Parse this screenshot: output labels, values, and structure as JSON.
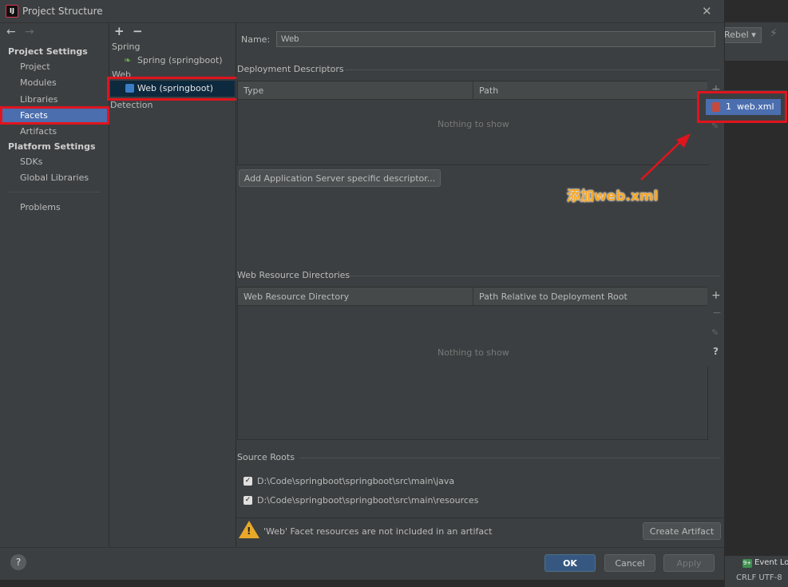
{
  "window": {
    "title": "Project Structure",
    "app_icon_label": "IJ"
  },
  "nav": {
    "back": "←",
    "forward": "→",
    "project_settings": "Project Settings",
    "project_items": [
      "Project",
      "Modules",
      "Libraries",
      "Facets",
      "Artifacts"
    ],
    "platform_settings": "Platform Settings",
    "platform_items": [
      "SDKs",
      "Global Libraries"
    ],
    "problems": "Problems",
    "selected": "Facets"
  },
  "facet_tree": {
    "add": "+",
    "remove": "−",
    "group_spring": "Spring",
    "spring_item": "Spring (springboot)",
    "group_web": "Web",
    "web_item": "Web (springboot)",
    "detection": "Detection"
  },
  "form": {
    "name_label": "Name:",
    "name_value": "Web",
    "deploy_title": "Deployment Descriptors",
    "deploy_cols": [
      "Type",
      "Path"
    ],
    "empty_text": "Nothing to show",
    "add_server_btn": "Add Application Server specific descriptor...",
    "webres_title": "Web Resource Directories",
    "webres_cols": [
      "Web Resource Directory",
      "Path Relative to Deployment Root"
    ],
    "source_title": "Source Roots",
    "source_roots": [
      "D:\\Code\\springboot\\springboot\\src\\main\\java",
      "D:\\Code\\springboot\\springboot\\src\\main\\resources"
    ],
    "warning": "'Web' Facet resources are not included in an artifact",
    "create_artifact": "Create Artifact"
  },
  "popup": {
    "item": "1  web.xml"
  },
  "annotation": "添加web.xml",
  "buttons": {
    "ok": "OK",
    "cancel": "Cancel",
    "apply": "Apply",
    "help": "?"
  },
  "ide": {
    "rebel": "Rebel ▾",
    "event_log": "Event Log",
    "status": "CRLF  UTF-8"
  },
  "colors": {
    "selection": "#4b6eaf",
    "highlight": "#e0141e",
    "annotation": "#f6a623"
  }
}
